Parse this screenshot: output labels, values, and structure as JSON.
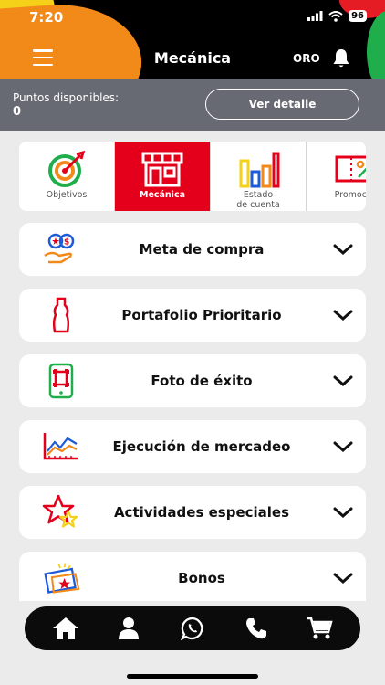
{
  "status_bar": {
    "time": "7:20",
    "battery": "96"
  },
  "header": {
    "title": "Mecánica",
    "level": "ORO"
  },
  "points": {
    "label": "Puntos disponibles:",
    "value": "0",
    "detail_button": "Ver detalle"
  },
  "tabs": [
    {
      "label": "Objetivos",
      "icon": "target-icon",
      "active": false
    },
    {
      "label": "Mecánica",
      "icon": "store-icon",
      "active": true
    },
    {
      "label": "Estado\nde cuenta",
      "icon": "bar-chart-icon",
      "active": false
    },
    {
      "label": "Promocio",
      "icon": "coupon-icon",
      "active": false
    }
  ],
  "sections": [
    {
      "label": "Meta de compra",
      "icon": "coins-hand-icon"
    },
    {
      "label": "Portafolio Prioritario",
      "icon": "bottle-icon"
    },
    {
      "label": "Foto de éxito",
      "icon": "phone-camera-icon"
    },
    {
      "label": "Ejecución de mercadeo",
      "icon": "line-chart-icon"
    },
    {
      "label": "Actividades especiales",
      "icon": "stars-icon"
    },
    {
      "label": "Bonos",
      "icon": "gift-ticket-icon"
    }
  ],
  "bottom_nav": [
    "home-icon",
    "profile-icon",
    "whatsapp-icon",
    "phone-icon",
    "cart-icon"
  ],
  "colors": {
    "accent_red": "#e4001b",
    "header_bg": "#000000",
    "points_bg": "#676a72",
    "page_bg": "#ebebeb"
  }
}
